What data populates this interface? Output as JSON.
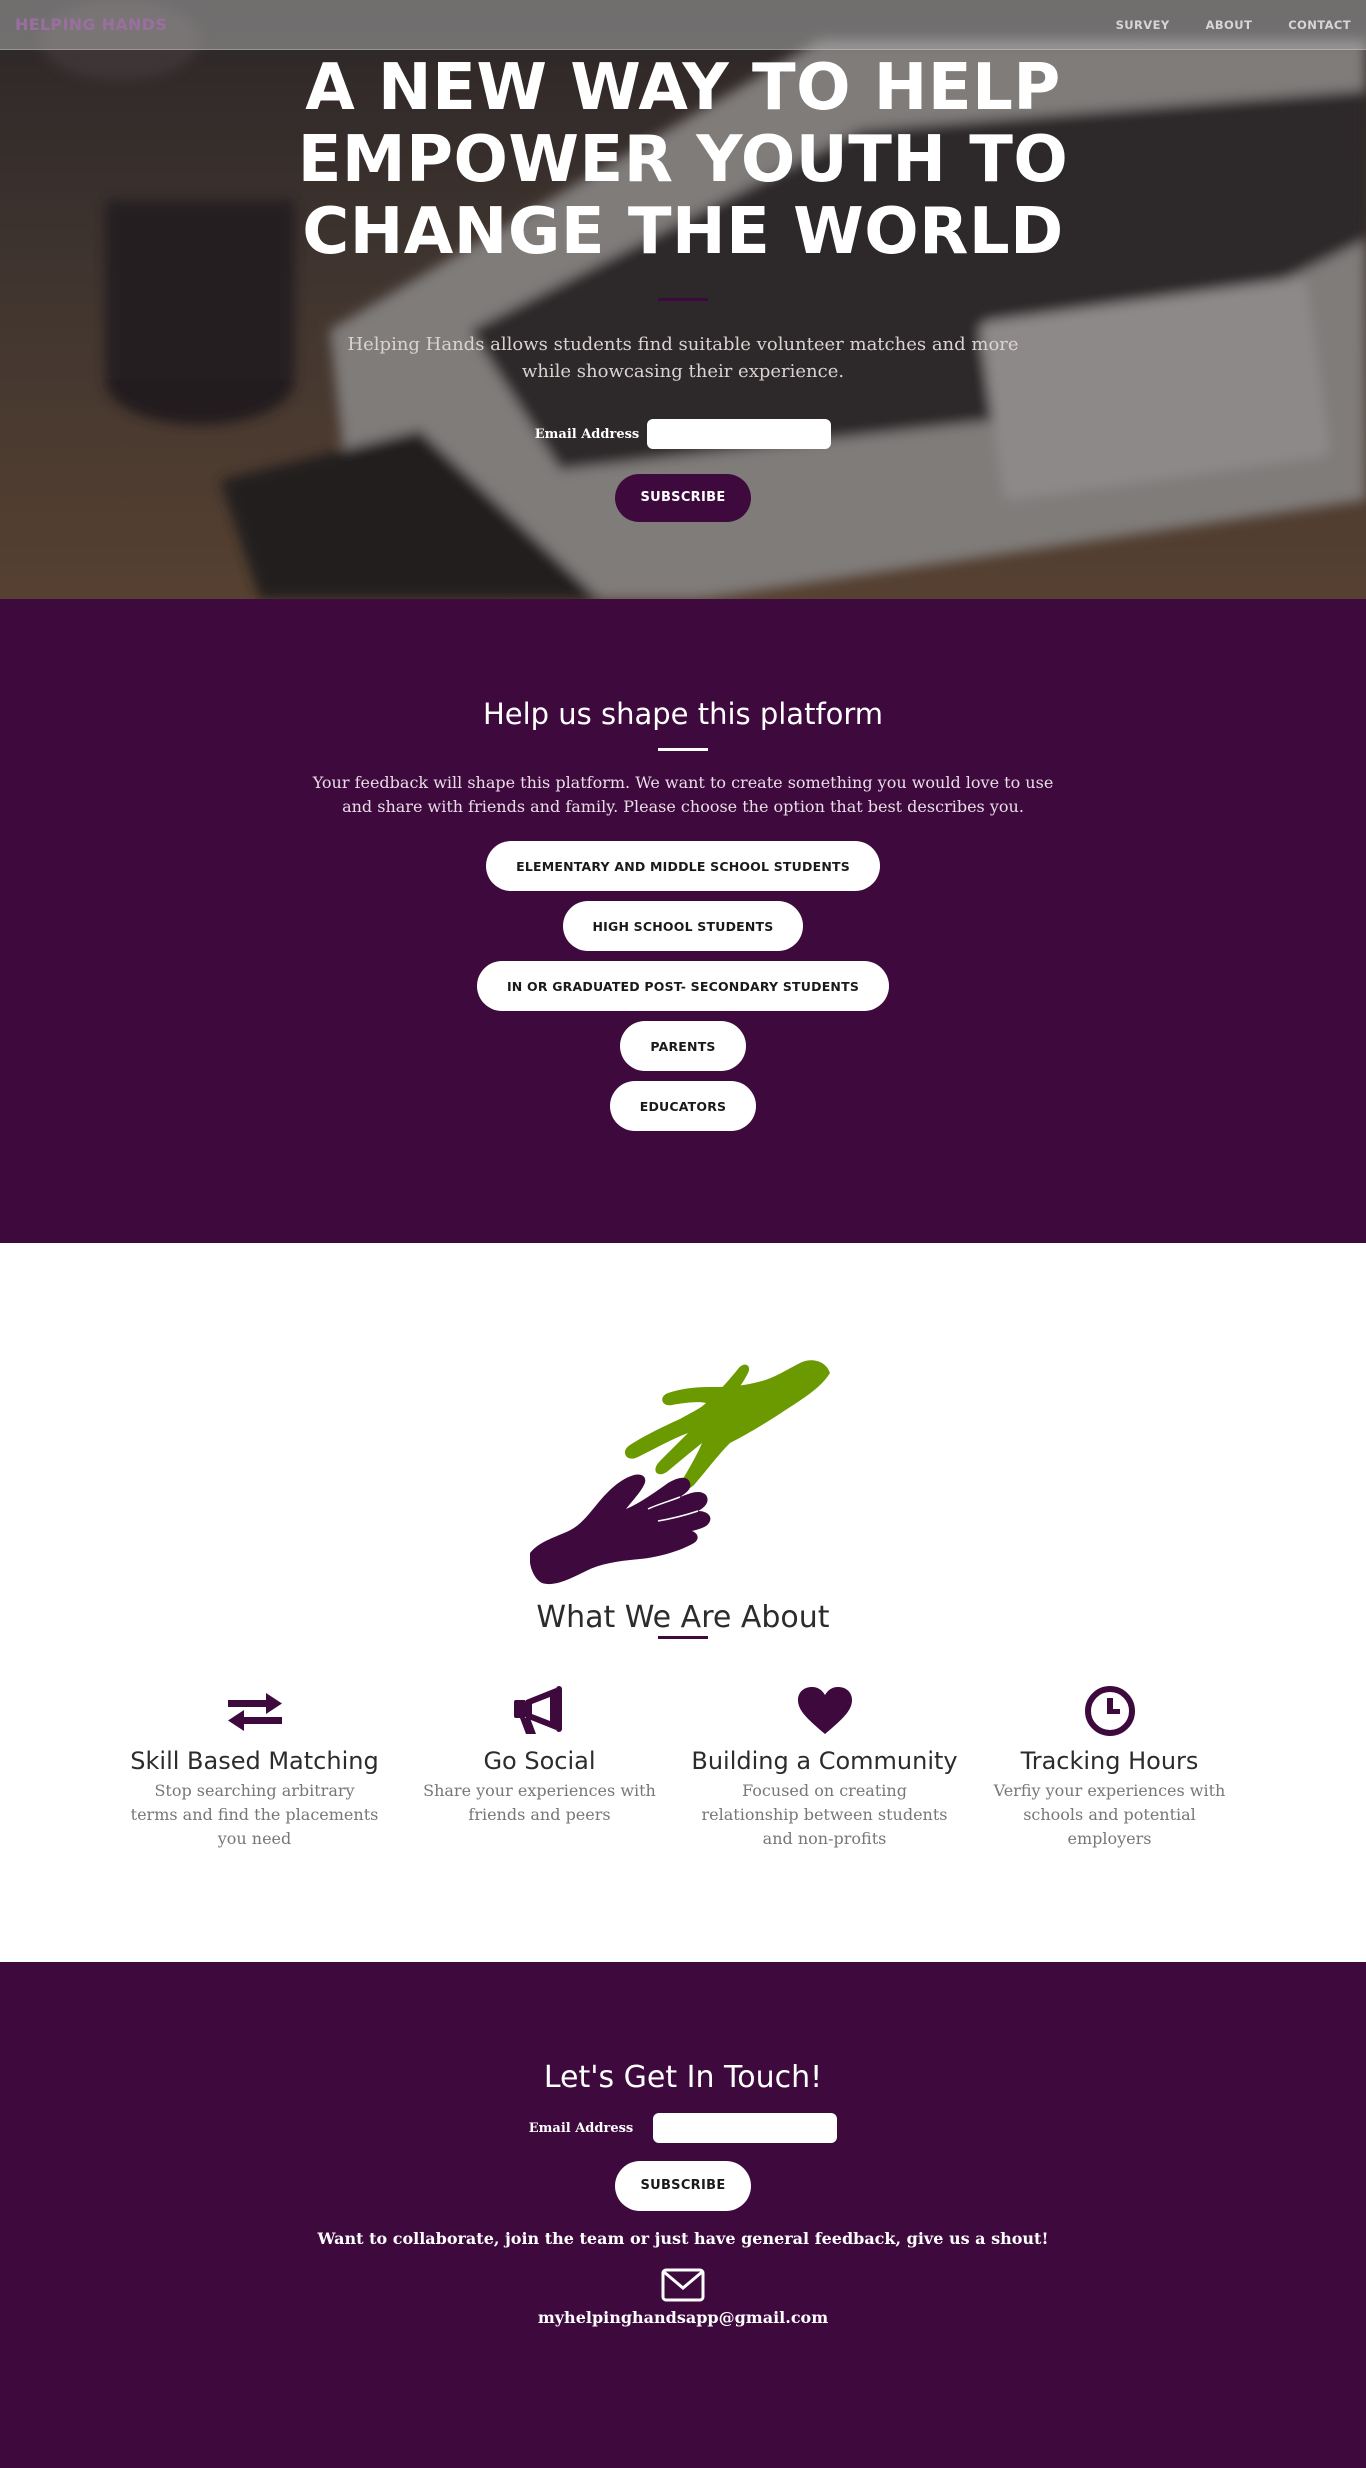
{
  "nav": {
    "brand": "HELPING HANDS",
    "links": [
      "SURVEY",
      "ABOUT",
      "CONTACT"
    ]
  },
  "hero": {
    "title": "A NEW WAY TO HELP EMPOWER YOUTH TO CHANGE THE WORLD",
    "subtitle": "Helping Hands allows students find suitable volunteer matches and more while showcasing their experience.",
    "email_label": "Email Address",
    "email_value": "",
    "subscribe_label": "SUBSCRIBE"
  },
  "survey": {
    "title": "Help us shape this platform",
    "text": "Your feedback will shape this platform. We want to create something you would love to use and share with friends and family. Please choose the option that best describes you.",
    "options": [
      "ELEMENTARY AND MIDDLE SCHOOL STUDENTS",
      "HIGH SCHOOL STUDENTS",
      "IN OR GRADUATED POST- SECONDARY STUDENTS",
      "PARENTS",
      "EDUCATORS"
    ]
  },
  "about": {
    "title": "What We Are About",
    "features": [
      {
        "icon": "exchange-arrows-icon",
        "title": "Skill Based Matching",
        "text": "Stop searching arbitrary terms and find the placements you need"
      },
      {
        "icon": "megaphone-icon",
        "title": "Go Social",
        "text": "Share your experiences with friends and peers"
      },
      {
        "icon": "heart-icon",
        "title": "Building a Community",
        "text": "Focused on creating relationship between students and non-profits"
      },
      {
        "icon": "clock-icon",
        "title": "Tracking Hours",
        "text": "Verfiy your experiences with schools and potential employers"
      }
    ]
  },
  "contact": {
    "title": "Let's Get In Touch!",
    "email_label": "Email Address",
    "email_value": "",
    "subscribe_label": "SUBSCRIBE",
    "text": "Want to collaborate, join the team or just have general feedback, give us a shout!",
    "email": "myhelpinghandsapp@gmail.com"
  },
  "colors": {
    "brand_purple": "#3e0a3e",
    "hand_green": "#6a9a00",
    "text_gray": "#777777"
  }
}
